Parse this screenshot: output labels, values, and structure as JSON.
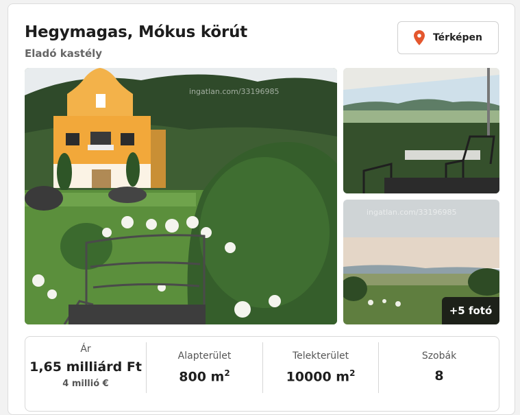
{
  "listing": {
    "title": "Hegymagas, Mókus körút",
    "subtitle": "Eladó kastély"
  },
  "map_button": {
    "label": "Térképen",
    "icon": "location-pin-icon",
    "icon_color": "#e4572e"
  },
  "gallery": {
    "watermark": "ingatlan.com/33196985",
    "more_photos_label": "+5 fotó"
  },
  "stats": {
    "price": {
      "label": "Ár",
      "value": "1,65 milliárd Ft",
      "sub": "4 millió €"
    },
    "floor_area": {
      "label": "Alapterület",
      "value": "800 m",
      "unit_sup": "2"
    },
    "plot_area": {
      "label": "Telekterület",
      "value": "10000 m",
      "unit_sup": "2"
    },
    "rooms": {
      "label": "Szobák",
      "value": "8"
    }
  }
}
